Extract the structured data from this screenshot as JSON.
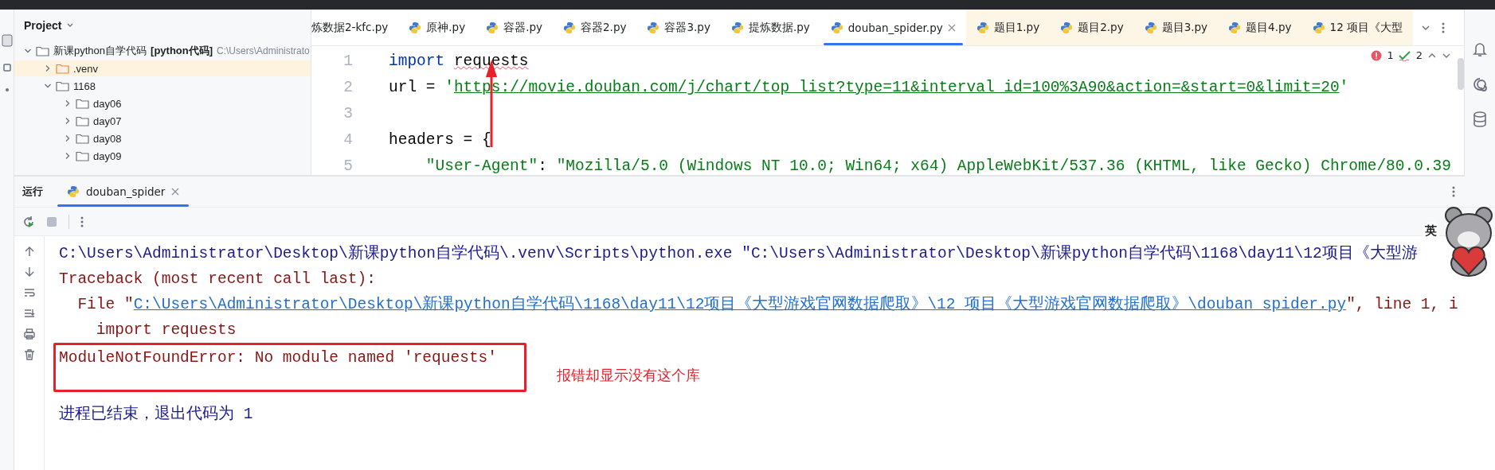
{
  "project": {
    "title": "Project",
    "tree": [
      {
        "name": "新课python自学代码",
        "module": "[python代码]",
        "path": "C:\\Users\\Administrato",
        "kind": "folder",
        "expanded": true,
        "selected": false,
        "children": [
          {
            "name": ".venv",
            "kind": "venv",
            "expanded": false,
            "selected": true
          },
          {
            "name": "1168",
            "kind": "folder",
            "expanded": true,
            "selected": false,
            "children": [
              {
                "name": "day06",
                "kind": "folder",
                "expanded": false,
                "selected": false
              },
              {
                "name": "day07",
                "kind": "folder",
                "expanded": false,
                "selected": false
              },
              {
                "name": "day08",
                "kind": "folder",
                "expanded": false,
                "selected": false
              },
              {
                "name": "day09",
                "kind": "folder",
                "expanded": false,
                "selected": false
              }
            ]
          }
        ]
      }
    ]
  },
  "editor": {
    "tabs": [
      {
        "label": "炼数据2-kfc.py",
        "icon": false,
        "selected": false,
        "highlighted": false
      },
      {
        "label": "原神.py",
        "icon": true,
        "selected": false,
        "highlighted": false
      },
      {
        "label": "容器.py",
        "icon": true,
        "selected": false,
        "highlighted": false
      },
      {
        "label": "容器2.py",
        "icon": true,
        "selected": false,
        "highlighted": false
      },
      {
        "label": "容器3.py",
        "icon": true,
        "selected": false,
        "highlighted": false
      },
      {
        "label": "提炼数据.py",
        "icon": true,
        "selected": false,
        "highlighted": false
      },
      {
        "label": "douban_spider.py",
        "icon": true,
        "selected": true,
        "highlighted": false
      },
      {
        "label": "题目1.py",
        "icon": true,
        "selected": false,
        "highlighted": true
      },
      {
        "label": "题目2.py",
        "icon": true,
        "selected": false,
        "highlighted": true
      },
      {
        "label": "题目3.py",
        "icon": true,
        "selected": false,
        "highlighted": true
      },
      {
        "label": "题目4.py",
        "icon": true,
        "selected": false,
        "highlighted": true
      },
      {
        "label": "12 项目《大型",
        "icon": true,
        "selected": false,
        "highlighted": true
      }
    ],
    "inspections": {
      "errors": "1",
      "warnings": "2"
    },
    "lines": [
      {
        "number": "1",
        "segments": [
          {
            "text": "import ",
            "kind": "keyword"
          },
          {
            "text": "requests",
            "kind": "unresolved"
          }
        ]
      },
      {
        "number": "2",
        "segments": [
          {
            "text": "url = ",
            "kind": "plain"
          },
          {
            "text": "'",
            "kind": "string"
          },
          {
            "text": "https://movie.douban.com/j/chart/top_list?type=11&interval_id=100%3A90&action=&start=0&limit=20",
            "kind": "link"
          },
          {
            "text": "'",
            "kind": "string"
          }
        ]
      },
      {
        "number": "3"
      },
      {
        "number": "4",
        "segments": [
          {
            "text": "headers = {",
            "kind": "plain"
          }
        ]
      },
      {
        "number": "5",
        "segments": [
          {
            "text": "    \"User-Agent\"",
            "kind": "string"
          },
          {
            "text": ": ",
            "kind": "plain"
          },
          {
            "text": "\"Mozilla/5.0 (Windows NT 10.0; Win64; x64) AppleWebKit/537.36 (KHTML, like Gecko) Chrome/80.0.39",
            "kind": "string"
          }
        ]
      }
    ]
  },
  "run": {
    "label": "运行",
    "tabs": [
      {
        "label": "douban_spider",
        "selected": true
      }
    ],
    "console": [
      {
        "kind": "command",
        "text": "C:\\Users\\Administrator\\Desktop\\新课python自学代码\\.venv\\Scripts\\python.exe \"C:\\Users\\Administrator\\Desktop\\新课python自学代码\\1168\\day11\\12项目《大型游"
      },
      {
        "kind": "traceback",
        "text": "Traceback (most recent call last):"
      },
      {
        "kind": "file",
        "prefix": "  File \"",
        "link": "C:\\Users\\Administrator\\Desktop\\新课python自学代码\\1168\\day11\\12项目《大型游戏官网数据爬取》\\12 项目《大型游戏官网数据爬取》\\douban_spider.py",
        "suffix": "\", line 1, i"
      },
      {
        "kind": "code",
        "text": "    import requests"
      },
      {
        "kind": "error",
        "text": "ModuleNotFoundError: No module named 'requests'",
        "boxed": true,
        "annotation": "报错却显示没有这个库"
      },
      {
        "kind": "exit",
        "text": "进程已结束，退出代码为 1"
      }
    ]
  },
  "sticker": {
    "badge": "英"
  }
}
